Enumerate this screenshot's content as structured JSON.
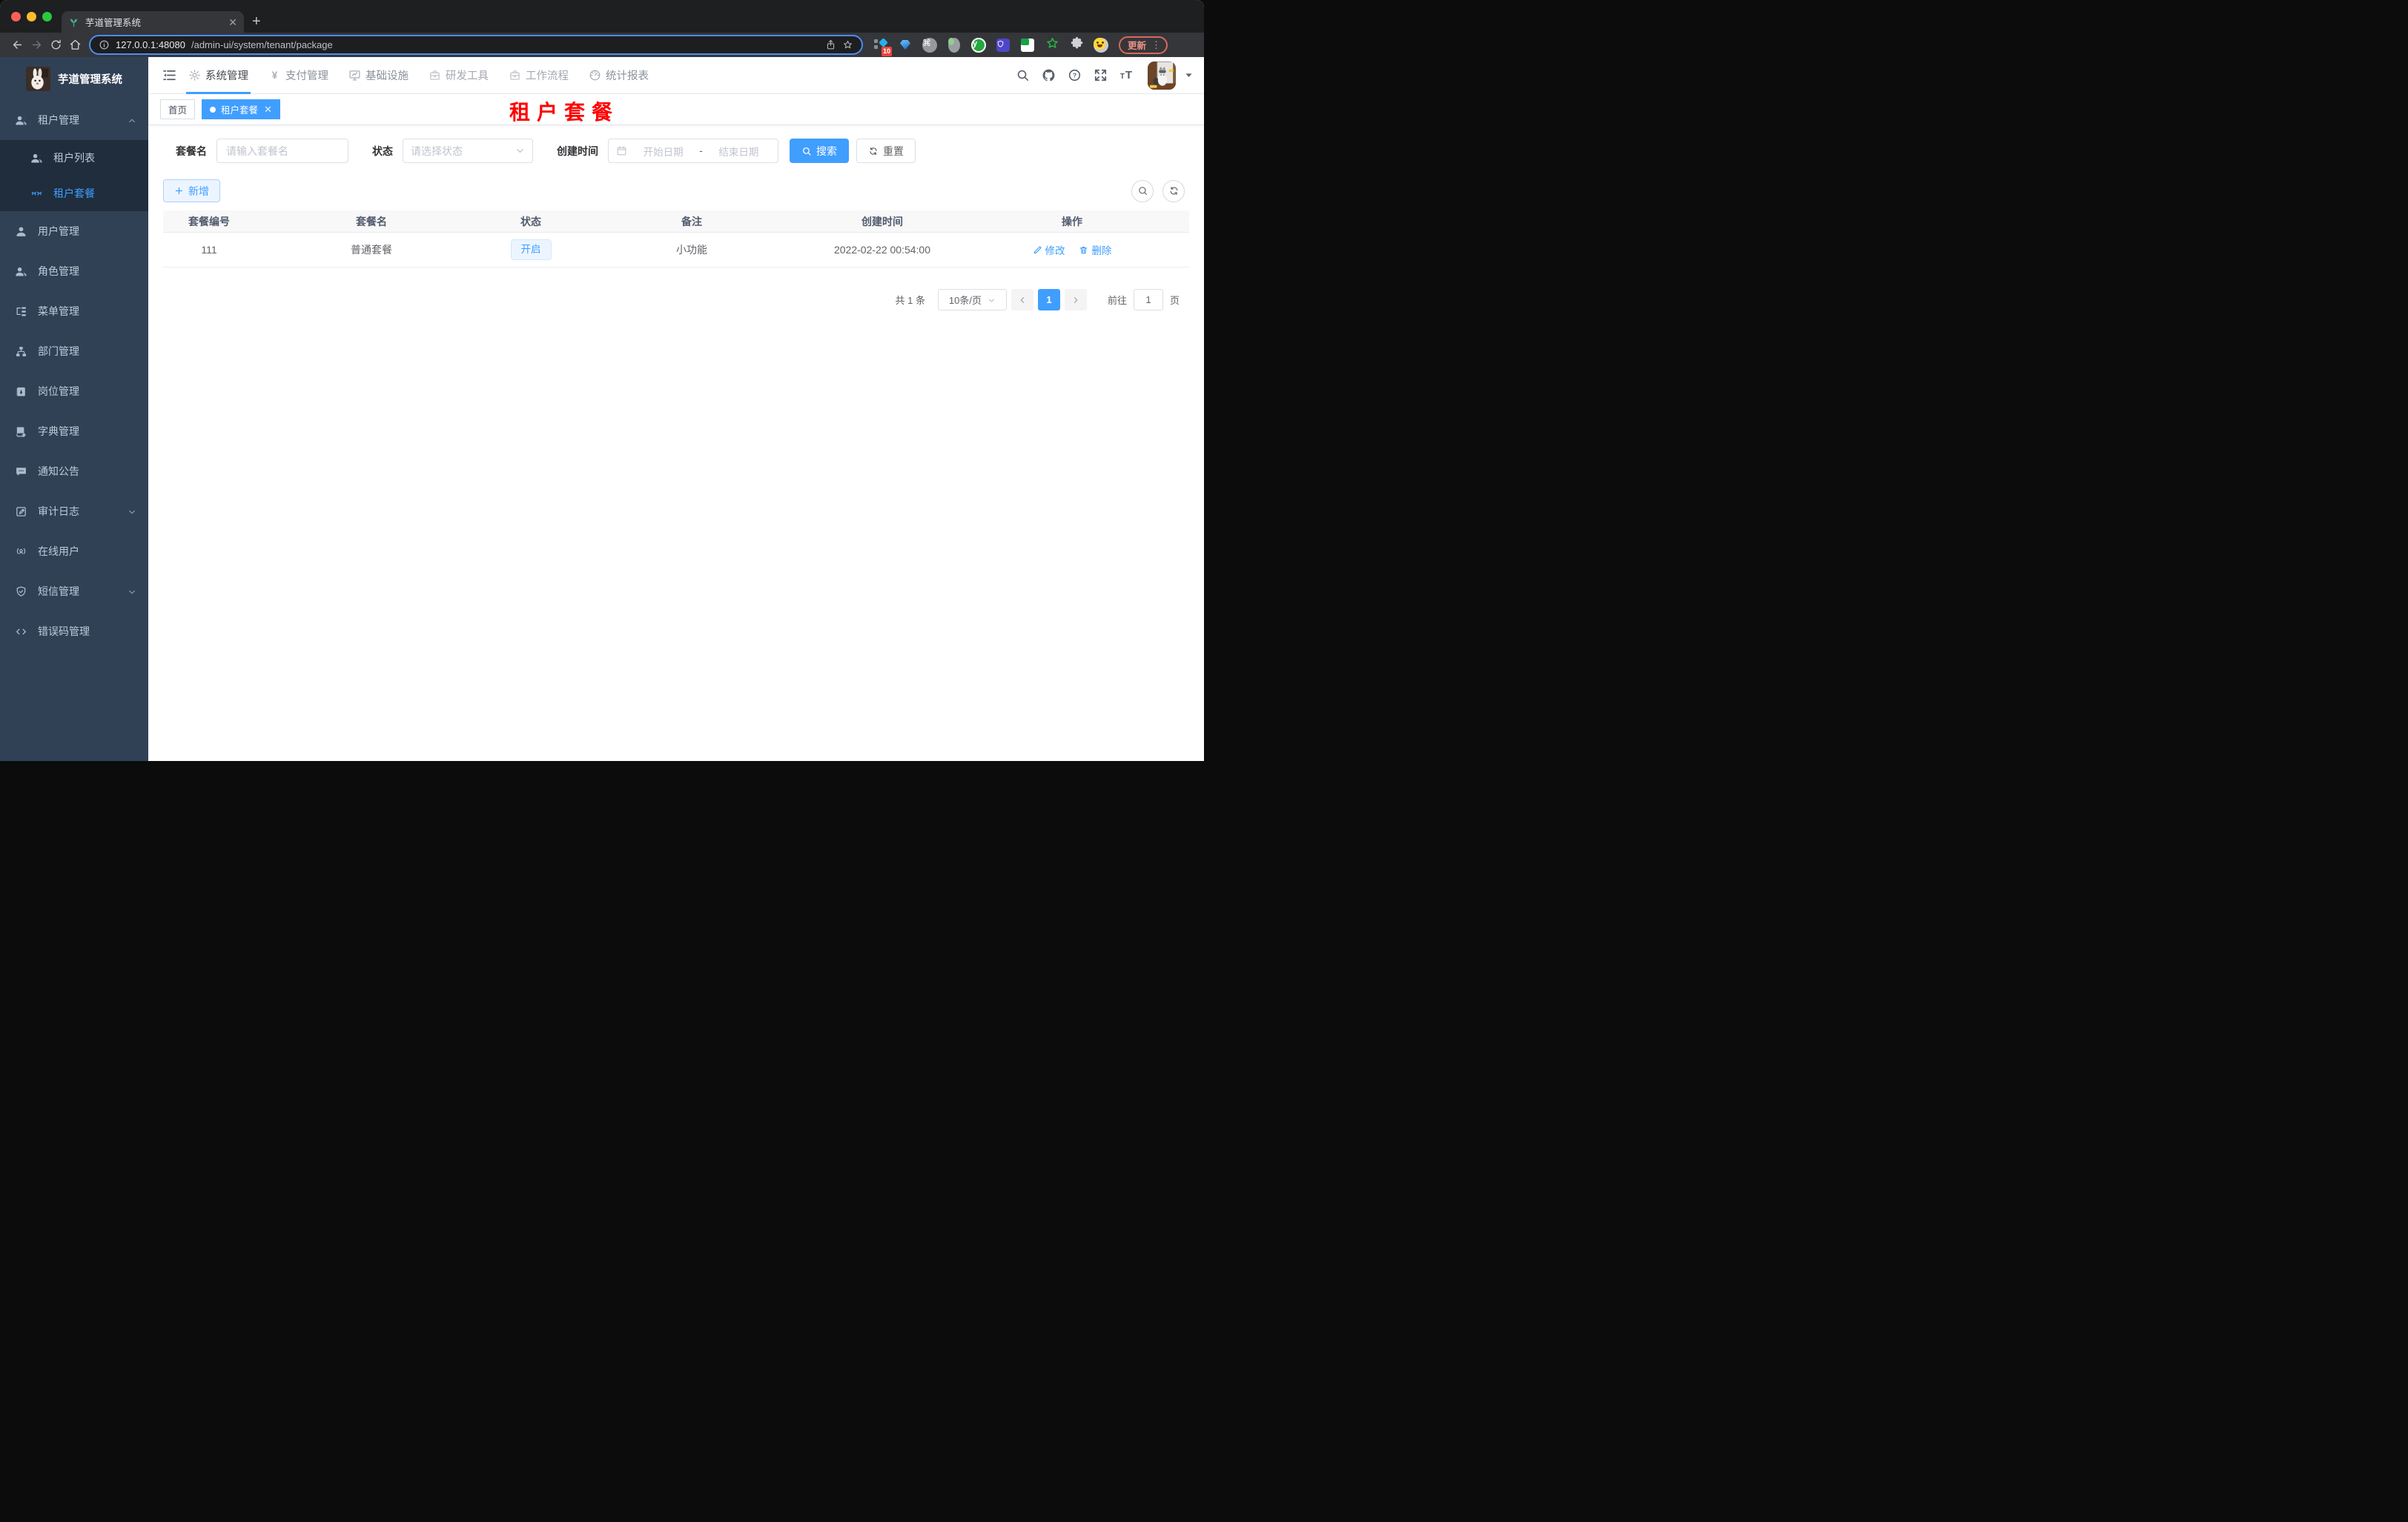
{
  "browser": {
    "window_buttons": [
      "close",
      "minimize",
      "zoom"
    ],
    "tab": {
      "title": "芋道管理系统",
      "favicon": "plant-icon"
    },
    "nav_icons": [
      "back-icon",
      "forward-icon",
      "reload-icon",
      "home-icon"
    ],
    "url": {
      "host": "127.0.0.1:48080",
      "path": "/admin-ui/system/tenant/package",
      "info_icon": "info-icon",
      "share_icon": "share-icon",
      "bookmark_icon": "star-icon"
    },
    "extensions": [
      {
        "name": "grid-diamond",
        "badge": "10"
      },
      {
        "name": "gem"
      },
      {
        "name": "command"
      },
      {
        "name": "oval-green"
      },
      {
        "name": "y-circle"
      },
      {
        "name": "shield-purple"
      },
      {
        "name": "chat-green"
      },
      {
        "name": "star-green"
      },
      {
        "name": "puzzle"
      },
      {
        "name": "emoji-face"
      }
    ],
    "update_button": "更新",
    "menu_icon": "⋮"
  },
  "sidebar": {
    "app_title": "芋道管理系统",
    "items": [
      {
        "id": "tenant",
        "label": "租户管理",
        "icon": "users-icon",
        "chevron": "up"
      },
      {
        "id": "tenant-list",
        "label": "租户列表",
        "icon": "users-icon",
        "sub": true
      },
      {
        "id": "tenant-package",
        "label": "租户套餐",
        "icon": "tenant-package-icon",
        "sub": true,
        "active": true
      },
      {
        "id": "user",
        "label": "用户管理",
        "icon": "user-icon"
      },
      {
        "id": "role",
        "label": "角色管理",
        "icon": "users-icon"
      },
      {
        "id": "menu",
        "label": "菜单管理",
        "icon": "menu-tree-icon"
      },
      {
        "id": "dept",
        "label": "部门管理",
        "icon": "org-icon"
      },
      {
        "id": "post",
        "label": "岗位管理",
        "icon": "badge-icon"
      },
      {
        "id": "dict",
        "label": "字典管理",
        "icon": "dict-icon"
      },
      {
        "id": "notice",
        "label": "通知公告",
        "icon": "message-icon"
      },
      {
        "id": "audit",
        "label": "审计日志",
        "icon": "log-icon",
        "chevron": "down"
      },
      {
        "id": "online",
        "label": "在线用户",
        "icon": "online-icon"
      },
      {
        "id": "sms",
        "label": "短信管理",
        "icon": "shield-icon",
        "chevron": "down"
      },
      {
        "id": "errcode",
        "label": "错误码管理",
        "icon": "code-icon"
      }
    ]
  },
  "app_header": {
    "collapse_icon": "collapse-icon",
    "menus": [
      {
        "id": "system",
        "label": "系统管理",
        "icon": "gear-icon",
        "active": true
      },
      {
        "id": "pay",
        "label": "支付管理",
        "icon": "yen-icon"
      },
      {
        "id": "infra",
        "label": "基础设施",
        "icon": "monitor-icon"
      },
      {
        "id": "dev",
        "label": "研发工具",
        "icon": "briefcase-icon",
        "muted": true
      },
      {
        "id": "flow",
        "label": "工作流程",
        "icon": "briefcase-icon",
        "muted": true
      },
      {
        "id": "report",
        "label": "统计报表",
        "icon": "dashboard-icon"
      }
    ],
    "right_icons": [
      "search-icon",
      "github-icon",
      "help-icon",
      "fullscreen-icon",
      "font-size-icon",
      "avatar",
      "dropdown-caret-icon"
    ]
  },
  "tags": {
    "items": [
      {
        "label": "首页"
      },
      {
        "label": "租户套餐",
        "active": true,
        "closable": true
      }
    ]
  },
  "annotation": {
    "text": "租户套餐",
    "color": "#ff0000"
  },
  "filters": {
    "name_label": "套餐名",
    "name_placeholder": "请输入套餐名",
    "status_label": "状态",
    "status_placeholder": "请选择状态",
    "date_label": "创建时间",
    "date_start_placeholder": "开始日期",
    "date_separator": "-",
    "date_end_placeholder": "结束日期",
    "search_label": "搜索",
    "reset_label": "重置"
  },
  "toolbar": {
    "add_label": "新增"
  },
  "table": {
    "headers": [
      "套餐编号",
      "套餐名",
      "状态",
      "备注",
      "创建时间",
      "操作"
    ],
    "rows": [
      {
        "id": "111",
        "name": "普通套餐",
        "status": "开启",
        "remark": "小功能",
        "created_at": "2022-02-22 00:54:00"
      }
    ],
    "row_actions": {
      "edit": "修改",
      "delete": "删除"
    }
  },
  "pagination": {
    "total": "共 1 条",
    "page_size": "10条/页",
    "current": "1",
    "goto_label": "前往",
    "goto_value": "1",
    "unit_label": "页"
  },
  "colors": {
    "primary": "#409eff",
    "sidebar_bg": "#304156",
    "submenu_bg": "#1f2d3d",
    "tag_active_bg": "#409eff",
    "status_tag_bg": "#ecf5ff",
    "annotation_red": "#ff0000",
    "table_header_bg": "#f8f8f9"
  }
}
